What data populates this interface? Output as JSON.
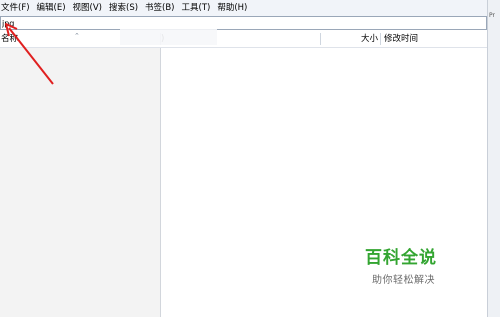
{
  "menubar": {
    "items": [
      {
        "label": "文件(F)"
      },
      {
        "label": "编辑(E)"
      },
      {
        "label": "视图(V)"
      },
      {
        "label": "搜索(S)"
      },
      {
        "label": "书签(B)"
      },
      {
        "label": "工具(T)"
      },
      {
        "label": "帮助(H)"
      }
    ]
  },
  "search": {
    "value": "jpg"
  },
  "columns": {
    "name": "名称",
    "size": "大小",
    "modified": "修改时间",
    "partial": ")"
  },
  "right_strip": {
    "label": "Pr"
  },
  "watermark": {
    "main": "百科全说",
    "sub": "助你轻松解决",
    "color": "#33a531"
  },
  "annotation": {
    "arrow_color": "#e02020"
  }
}
